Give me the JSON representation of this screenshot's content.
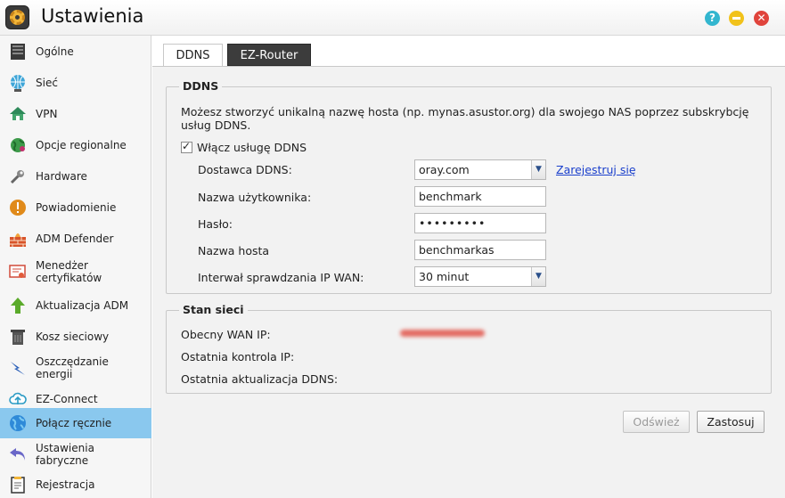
{
  "window": {
    "title": "Ustawienia"
  },
  "sidebar": {
    "items": [
      {
        "label": "Ogólne",
        "icon": "server-icon"
      },
      {
        "label": "Sieć",
        "icon": "globe-network-icon"
      },
      {
        "label": "VPN",
        "icon": "house-network-icon"
      },
      {
        "label": "Opcje regionalne",
        "icon": "region-globe-icon"
      },
      {
        "label": "Hardware",
        "icon": "wrench-icon"
      },
      {
        "label": "Powiadomienie",
        "icon": "alert-icon"
      },
      {
        "label": "ADM Defender",
        "icon": "firewall-icon"
      },
      {
        "label": "Menedżer certyfikatów",
        "icon": "certificate-icon"
      },
      {
        "label": "Aktualizacja ADM",
        "icon": "upgrade-arrow-icon"
      },
      {
        "label": "Kosz sieciowy",
        "icon": "trash-icon"
      },
      {
        "label": "Oszczędzanie energii",
        "icon": "energy-bolt-icon"
      },
      {
        "label": "EZ-Connect",
        "icon": "cloud-icon"
      },
      {
        "label": "Połącz ręcznie",
        "icon": "globe-icon"
      },
      {
        "label": "Ustawienia fabryczne",
        "icon": "undo-arrow-icon"
      },
      {
        "label": "Rejestracja",
        "icon": "registration-icon"
      }
    ],
    "active_index": 12
  },
  "tabs": {
    "ddns": "DDNS",
    "ez_router": "EZ-Router"
  },
  "ddns": {
    "legend": "DDNS",
    "description": "Możesz stworzyć unikalną nazwę hosta (np. mynas.asustor.org) dla swojego NAS poprzez subskrybcję usług DDNS.",
    "enable_label": "Włącz usługę DDNS",
    "provider_label": "Dostawca DDNS:",
    "provider_value": "oray.com",
    "register_link": "Zarejestruj się",
    "username_label": "Nazwa użytkownika:",
    "username_value": "benchmark",
    "password_label": "Hasło:",
    "password_value": "•••••••••",
    "hostname_label": "Nazwa hosta",
    "hostname_value": "benchmarkas",
    "interval_label": "Interwał sprawdzania IP WAN:",
    "interval_value": "30 minut"
  },
  "status": {
    "legend": "Stan sieci",
    "wan_ip_label": "Obecny WAN IP:",
    "last_check_label": "Ostatnia kontrola IP:",
    "last_update_label": "Ostatnia aktualizacja DDNS:"
  },
  "buttons": {
    "refresh": "Odśwież",
    "apply": "Zastosuj"
  }
}
